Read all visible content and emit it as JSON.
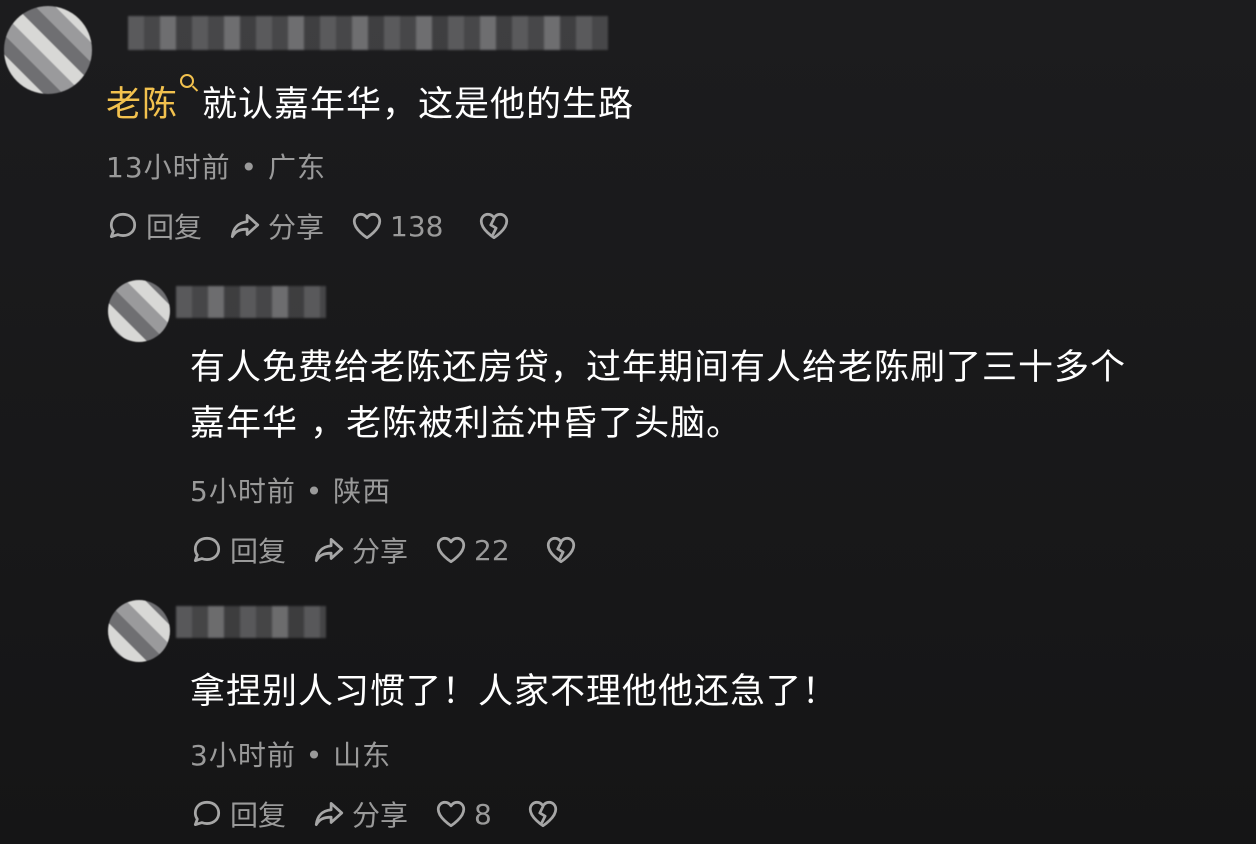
{
  "comments": [
    {
      "author": "老陈",
      "content": "就认嘉年华，这是他的生路",
      "time": "13小时前",
      "location": "广东",
      "reply_label": "回复",
      "share_label": "分享",
      "likes": "138"
    },
    {
      "content_line1": "有人免费给老陈还房贷，过年期间有人给老陈刷了三十多个",
      "content_line2": "嘉年华 ，老陈被利益冲昏了头脑。",
      "time": "5小时前",
      "location": "陕西",
      "reply_label": "回复",
      "share_label": "分享",
      "likes": "22"
    },
    {
      "content": "拿捏别人习惯了！人家不理他他还急了！",
      "time": "3小时前",
      "location": "山东",
      "reply_label": "回复",
      "share_label": "分享",
      "likes": "8"
    }
  ],
  "meta_separator": " • ",
  "icons": {
    "reply": "reply-bubble-icon",
    "share": "share-arrow-icon",
    "like": "heart-icon",
    "dislike": "broken-heart-icon"
  },
  "colors": {
    "background": "#1a1a1b",
    "text": "#ffffff",
    "meta": "#9a9a9a",
    "author": "#f2c14e"
  }
}
